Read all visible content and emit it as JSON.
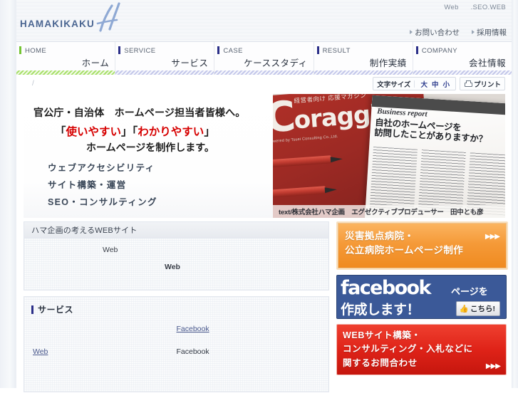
{
  "header": {
    "logo_text": "HAMAKIKAKU",
    "utility": {
      "item1": "Web",
      "item2": ".SEO.WEB"
    },
    "links": [
      {
        "label": "お問い合わせ"
      },
      {
        "label": "採用情報"
      }
    ]
  },
  "gnav": [
    {
      "en": "HOME",
      "ja": "ホーム",
      "accent": "#74c432"
    },
    {
      "en": "SERVICE",
      "ja": "サービス",
      "accent": "#2b2f88"
    },
    {
      "en": "CASE",
      "ja": "ケーススタディ",
      "accent": "#2b2f88"
    },
    {
      "en": "RESULT",
      "ja": "制作実績",
      "accent": "#2b2f88"
    },
    {
      "en": "COMPANY",
      "ja": "会社情報",
      "accent": "#2b2f88"
    }
  ],
  "utility_bar": {
    "breadcrumb": "/",
    "fontsize_label": "文字サイズ",
    "size_large": "大",
    "size_medium": "中",
    "size_small": "小",
    "print_label": "プリント"
  },
  "hero": {
    "line1": "官公庁・自治体　ホームページ担当者皆様へ。",
    "line2_open": "「",
    "line2_red1": "使いやすい",
    "line2_mid": "」「",
    "line2_red2": "わかりやすい",
    "line2_close": "」",
    "line3": "ホームページを制作します。",
    "bullets": [
      "ウェブアクセシビリティ",
      "サイト構築・運営",
      "SEO・コンサルティング"
    ],
    "photo": {
      "mag_big_letter": "C",
      "mag_title": "oraggio!!",
      "mag_kana": "経営者向け 応援マガジン",
      "mag_tiny": "Powered by Tsuei Consulting Co.,Ltd.",
      "report_label": "Business report",
      "report_head": "自社のホームページを\n訪問したことがありますか？",
      "caption": "text/株式会社ハマ企画　エグゼクティブプロデューサー　田中とも彦"
    }
  },
  "main": {
    "panel1": {
      "title": "ハマ企画の考えるWEBサイト",
      "line1": "Web",
      "line2": "Web"
    },
    "service": {
      "title": "サービス",
      "rows": [
        {
          "left": "",
          "right": "Facebook"
        },
        {
          "left": "",
          "right": "Facebook"
        },
        {
          "left": "Web",
          "right": ""
        }
      ]
    }
  },
  "banners": [
    {
      "name": "hospital",
      "line1": "災害拠点病院・",
      "line2": "公立病院ホームページ制作",
      "arrows": "▶▶▶",
      "color": "#f59a38"
    },
    {
      "name": "facebook",
      "word": "facebook",
      "ja1": "ページを",
      "ja2": "作成します！",
      "button": "こちら!",
      "color": "#3b5998"
    },
    {
      "name": "web-inquiry",
      "line1": "WEBサイト構築・",
      "line2": "コンサルティング・入札などに",
      "line3": "関するお問合わせ",
      "arrows": "▶▶▶",
      "color": "#df2318"
    }
  ]
}
